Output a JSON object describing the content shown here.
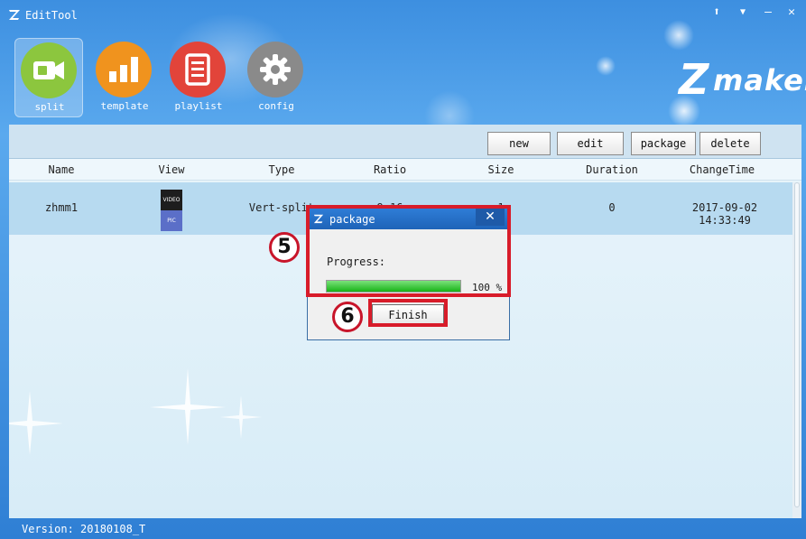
{
  "window": {
    "title": "EditTool",
    "controls": {
      "pin": "⬆",
      "dropdown": "▼",
      "minimize": "–",
      "close": "✕"
    }
  },
  "toolbar": {
    "items": [
      {
        "label": "split",
        "icon": "video-camera-icon",
        "color": "#8cc63e",
        "active": true
      },
      {
        "label": "template",
        "icon": "bar-chart-icon",
        "color": "#f0931e",
        "active": false
      },
      {
        "label": "playlist",
        "icon": "document-list-icon",
        "color": "#e2443a",
        "active": false
      },
      {
        "label": "config",
        "icon": "gear-icon",
        "color": "#8a8a8a",
        "active": false
      }
    ]
  },
  "brand": {
    "logo_letter": "Z",
    "logo_text": "maker"
  },
  "actions": {
    "new": "new",
    "edit": "edit",
    "package": "package",
    "delete": "delete"
  },
  "table": {
    "columns": [
      "Name",
      "View",
      "Type",
      "Ratio",
      "Size",
      "Duration",
      "ChangeTime"
    ],
    "rows": [
      {
        "name": "zhmm1",
        "view": {
          "top": "VIDEO",
          "bottom": "PIC"
        },
        "type": "Vert-split",
        "ratio": "9:16",
        "size": "1",
        "duration": "0",
        "change_time": "2017-09-02 14:33:49"
      }
    ]
  },
  "dialog": {
    "title": "package",
    "close_glyph": "✕",
    "progress_label": "Progress:",
    "progress": 100,
    "progress_text": "100 %",
    "finish_label": "Finish"
  },
  "annotations": {
    "step5": "5",
    "step6": "6",
    "highlight_color": "#d81c2a"
  },
  "status": {
    "version": "Version: 20180108_T"
  }
}
